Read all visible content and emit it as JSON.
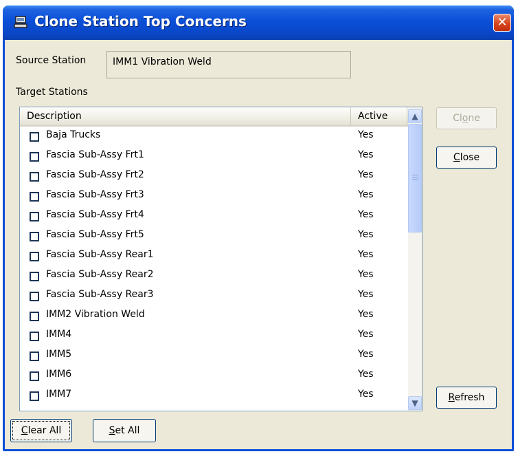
{
  "window": {
    "title": "Clone Station Top Concerns",
    "close_glyph": "✕",
    "icon": "clone-app-icon"
  },
  "source": {
    "label": "Source Station",
    "value": "IMM1 Vibration Weld"
  },
  "target": {
    "label": "Target Stations"
  },
  "list": {
    "columns": {
      "description": "Description",
      "active": "Active"
    },
    "rows": [
      {
        "description": "Baja Trucks",
        "active": "Yes",
        "checked": false
      },
      {
        "description": "Fascia Sub-Assy Frt1",
        "active": "Yes",
        "checked": false
      },
      {
        "description": "Fascia Sub-Assy Frt2",
        "active": "Yes",
        "checked": false
      },
      {
        "description": "Fascia Sub-Assy Frt3",
        "active": "Yes",
        "checked": false
      },
      {
        "description": "Fascia Sub-Assy Frt4",
        "active": "Yes",
        "checked": false
      },
      {
        "description": "Fascia Sub-Assy Frt5",
        "active": "Yes",
        "checked": false
      },
      {
        "description": "Fascia Sub-Assy Rear1",
        "active": "Yes",
        "checked": false
      },
      {
        "description": "Fascia Sub-Assy Rear2",
        "active": "Yes",
        "checked": false
      },
      {
        "description": "Fascia Sub-Assy Rear3",
        "active": "Yes",
        "checked": false
      },
      {
        "description": "IMM2 Vibration Weld",
        "active": "Yes",
        "checked": false
      },
      {
        "description": "IMM4",
        "active": "Yes",
        "checked": false
      },
      {
        "description": "IMM5",
        "active": "Yes",
        "checked": false
      },
      {
        "description": "IMM6",
        "active": "Yes",
        "checked": false
      },
      {
        "description": "IMM7",
        "active": "Yes",
        "checked": false
      }
    ]
  },
  "buttons": {
    "clone": {
      "first": "Cl",
      "mnemonic": "o",
      "rest": "ne",
      "enabled": false
    },
    "close": {
      "first": "",
      "mnemonic": "C",
      "rest": "lose"
    },
    "refresh": {
      "first": "",
      "mnemonic": "R",
      "rest": "efresh"
    },
    "clear_all": {
      "first": "",
      "mnemonic": "C",
      "rest": "lear All"
    },
    "set_all": {
      "first": "",
      "mnemonic": "S",
      "rest": "et All"
    }
  },
  "colors": {
    "titlebar": "#0a4fd8",
    "dialog_bg": "#ece9d8",
    "close_button": "#d7451c",
    "disabled_text": "#aca899"
  }
}
